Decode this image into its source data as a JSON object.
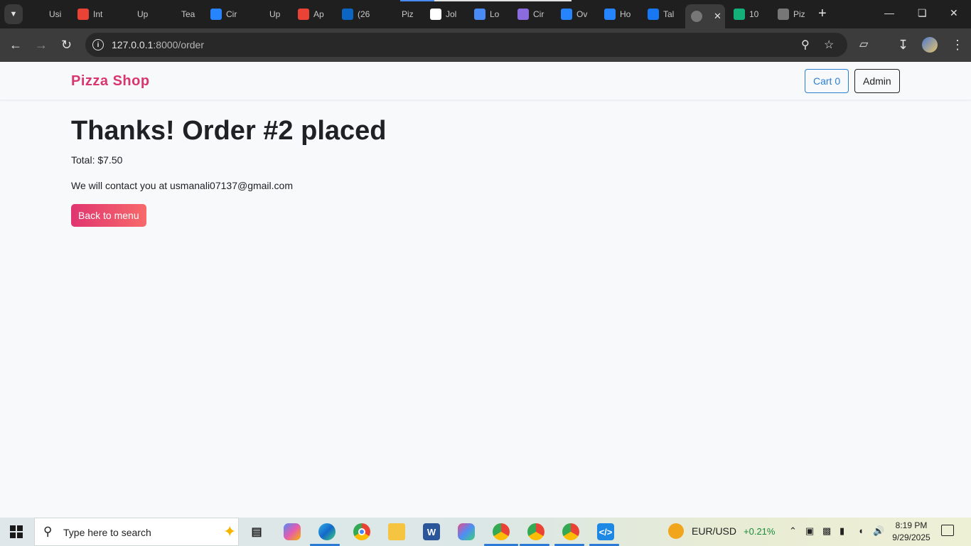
{
  "browser": {
    "tabs": [
      {
        "label": "Usi",
        "icon": "upwork-icon",
        "color": "#1f1f1f"
      },
      {
        "label": "Int",
        "icon": "gmail-icon",
        "color": "#ea4335"
      },
      {
        "label": "Up",
        "icon": "upwork-icon",
        "color": "#1f1f1f"
      },
      {
        "label": "Tea",
        "icon": "upwork-icon",
        "color": "#1f1f1f"
      },
      {
        "label": "Cir",
        "icon": "jira-icon",
        "color": "#2684ff"
      },
      {
        "label": "Up",
        "icon": "upwork-icon",
        "color": "#1f1f1f"
      },
      {
        "label": "Ap",
        "icon": "gmail-icon",
        "color": "#ea4335"
      },
      {
        "label": "(26",
        "icon": "linkedin-icon",
        "color": "#0a66c2"
      },
      {
        "label": "Piz",
        "icon": "chatgpt-icon",
        "color": "#1f1f1f"
      },
      {
        "label": "Jol",
        "icon": "info-icon",
        "color": "#ffffff"
      },
      {
        "label": "Lo",
        "icon": "loader-icon",
        "color": "#4a8af4"
      },
      {
        "label": "Cir",
        "icon": "circle-dots-icon",
        "color": "#8a6be0"
      },
      {
        "label": "Ov",
        "icon": "bitbucket-icon",
        "color": "#2684ff"
      },
      {
        "label": "Ho",
        "icon": "refresh-icon",
        "color": "#2684ff"
      },
      {
        "label": "Tal",
        "icon": "facebook-icon",
        "color": "#1877f2"
      }
    ],
    "active_tab_icon": "globe-icon",
    "tabs_after": [
      {
        "label": "10",
        "icon": "evernote-icon",
        "color": "#13b07a"
      },
      {
        "label": "Piz",
        "icon": "globe-icon",
        "color": "#777777"
      }
    ],
    "url_host": "127.0.0.1",
    "url_path": ":8000/order"
  },
  "site": {
    "brand": "Pizza Shop",
    "cart_label": "Cart 0",
    "admin_label": "Admin"
  },
  "order": {
    "heading": "Thanks! Order #2 placed",
    "total_line": "Total: $7.50",
    "contact_line": "We will contact you at usmanali07137@gmail.com",
    "back_button": "Back to menu"
  },
  "taskbar": {
    "search_placeholder": "Type here to search",
    "fx_pair": "EUR/USD",
    "fx_change": "+0.21%",
    "time": "8:19 PM",
    "date": "9/29/2025"
  }
}
